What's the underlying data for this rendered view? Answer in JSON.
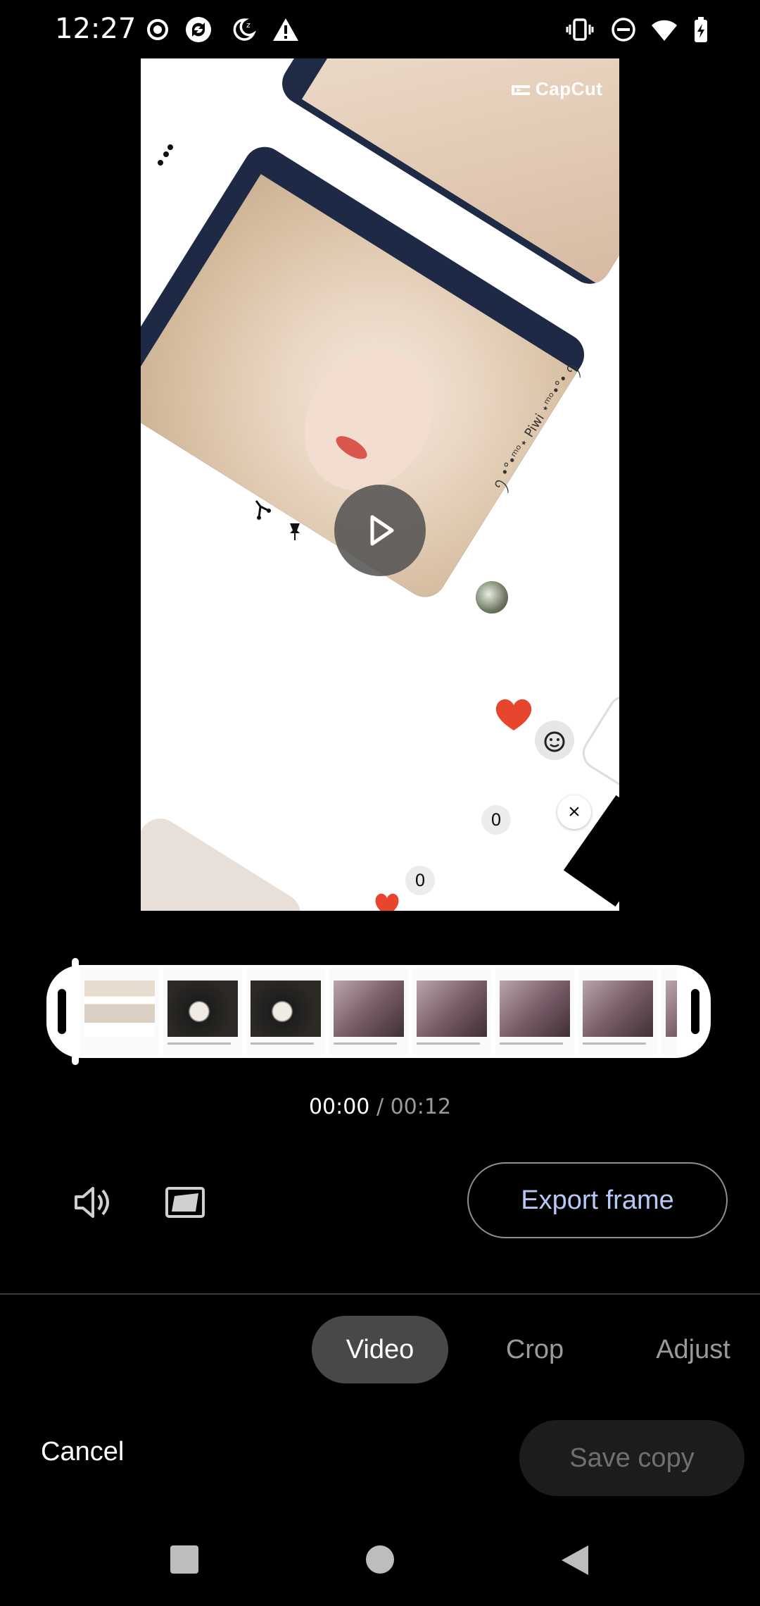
{
  "status_bar": {
    "time": "12:27",
    "left_icons": [
      "record-icon",
      "sync-icon",
      "do-not-disturb-moon-icon",
      "warning-icon"
    ],
    "right_icons": [
      "vibrate-icon",
      "do-not-disturb-icon",
      "wifi-icon",
      "battery-charging-icon"
    ]
  },
  "preview": {
    "watermark": "CapCut",
    "handle_text": "ꪆ •°•ᵐᵒ⋆ Piwi ⋆ᵐᵒ•°• ꪆ",
    "badge_counts": [
      "0",
      "0"
    ],
    "play_icon": "play-icon"
  },
  "timeline": {
    "current_time": "00:00",
    "separator": " / ",
    "total_time": "00:12"
  },
  "controls": {
    "export_label": "Export frame"
  },
  "tabs": [
    {
      "label": "Video",
      "selected": true
    },
    {
      "label": "Crop",
      "selected": false
    },
    {
      "label": "Adjust",
      "selected": false
    }
  ],
  "footer": {
    "cancel_label": "Cancel",
    "save_label": "Save copy"
  },
  "nav_bar": [
    "recents-icon",
    "home-icon",
    "back-icon"
  ],
  "colors": {
    "background": "#000000",
    "accent_text": "#b7c8f5",
    "selected_tab_bg": "#484848",
    "disabled_text": "#6f6f6f"
  }
}
